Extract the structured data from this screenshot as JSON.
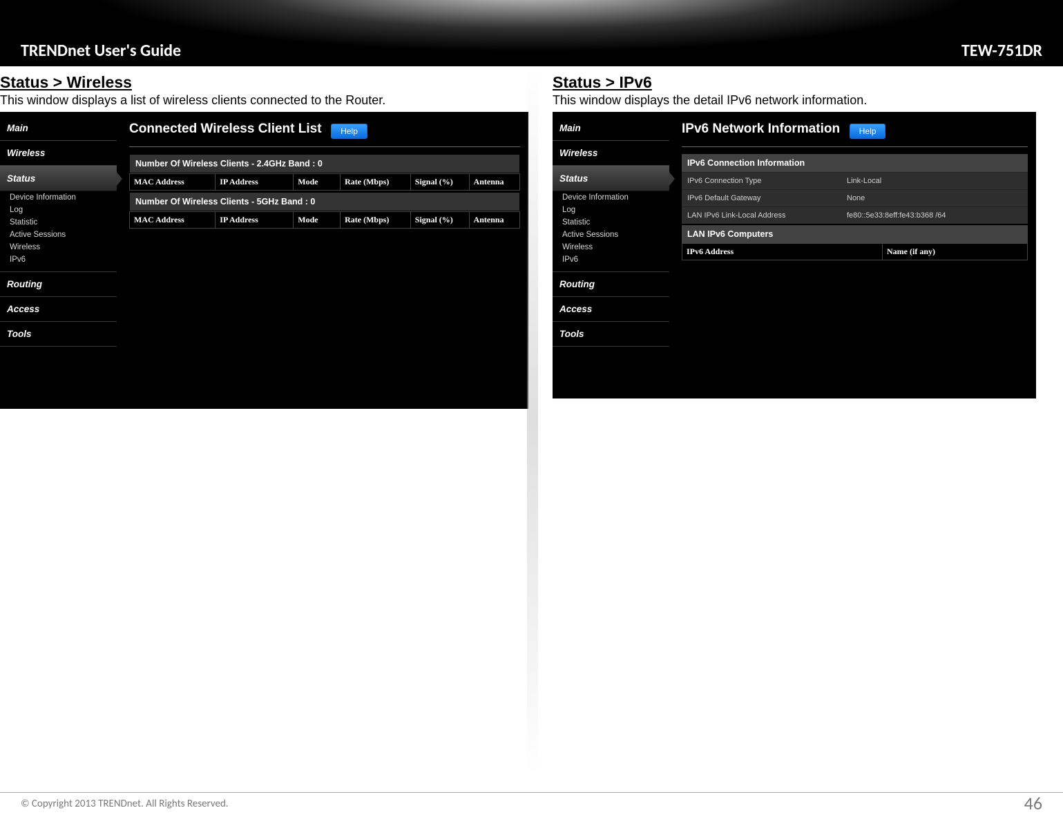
{
  "header": {
    "left": "TRENDnet User's Guide",
    "right": "TEW-751DR"
  },
  "left": {
    "title": "Status > Wireless",
    "desc": "This window displays a list of wireless clients connected to the Router.",
    "shot": {
      "page_title": "Connected Wireless Client List",
      "help": "Help",
      "menu": {
        "main": "Main",
        "wireless": "Wireless",
        "status": "Status",
        "routing": "Routing",
        "access": "Access",
        "tools": "Tools",
        "subs": [
          "Device Information",
          "Log",
          "Statistic",
          "Active Sessions",
          "Wireless",
          "IPv6"
        ]
      },
      "band24": "Number Of Wireless Clients - 2.4GHz Band : 0",
      "band5": "Number Of Wireless Clients - 5GHz Band : 0",
      "cols": [
        "MAC Address",
        "IP Address",
        "Mode",
        "Rate (Mbps)",
        "Signal (%)",
        "Antenna"
      ]
    }
  },
  "right": {
    "title": "Status > IPv6",
    "desc": "This window displays the detail IPv6 network information.",
    "shot": {
      "page_title": "IPv6 Network Information",
      "help": "Help",
      "menu": {
        "main": "Main",
        "wireless": "Wireless",
        "status": "Status",
        "routing": "Routing",
        "access": "Access",
        "tools": "Tools",
        "subs": [
          "Device Information",
          "Log",
          "Statistic",
          "Active Sessions",
          "Wireless",
          "IPv6"
        ]
      },
      "info_hdr": "IPv6 Connection Information",
      "rows": [
        {
          "k": "IPv6 Connection Type",
          "v": "Link-Local"
        },
        {
          "k": "IPv6 Default Gateway",
          "v": "None"
        },
        {
          "k": "LAN IPv6 Link-Local Address",
          "v": "fe80::5e33:8eff:fe43:b368 /64"
        }
      ],
      "lan_hdr": "LAN IPv6 Computers",
      "ipv6cols": [
        "IPv6 Address",
        "Name (if any)"
      ]
    }
  },
  "footer": {
    "copyright": "© Copyright 2013 TRENDnet. All Rights Reserved.",
    "page": "46"
  }
}
